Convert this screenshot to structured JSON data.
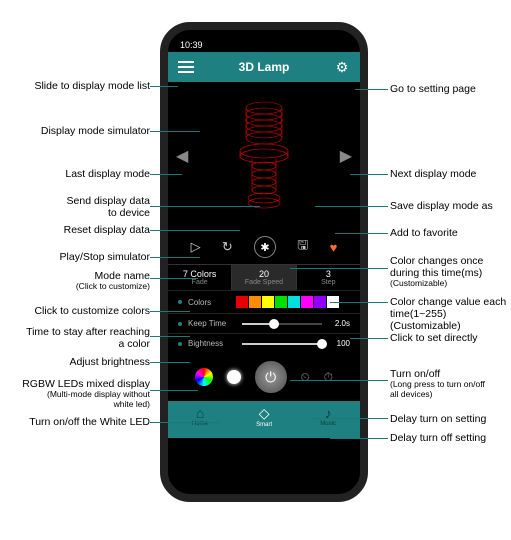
{
  "status": {
    "time": "10:39"
  },
  "header": {
    "title": "3D Lamp"
  },
  "controls": {
    "mode": {
      "val": "7 Colors",
      "lbl": "Fade"
    },
    "speed": {
      "val": "20",
      "lbl": "Fade Speed"
    },
    "step": {
      "val": "3",
      "lbl": "Step"
    }
  },
  "settings": {
    "colors_lbl": "Colors",
    "keep_lbl": "Keep Time",
    "keep_val": "2.0s",
    "bright_lbl": "Bightness",
    "bright_val": "100"
  },
  "swatches": [
    "#e60000",
    "#ff8c00",
    "#ffff00",
    "#00e000",
    "#00e0e0",
    "#ff00ff",
    "#9000ff",
    "#ffffff"
  ],
  "nav": {
    "home": "Home",
    "smart": "Smart",
    "music": "Music"
  },
  "callouts": {
    "l1": "Slide to display mode list",
    "l2": "Display mode simulator",
    "l3": "Last display mode",
    "l4a": "Send display data",
    "l4b": "to device",
    "l5": "Reset display data",
    "l6": "Play/Stop simulator",
    "l7a": "Mode name",
    "l7b": "(Click to customize)",
    "l8": "Click to customize colors",
    "l9a": "Time to stay after reaching",
    "l9b": "a color",
    "l10": "Adjust brightness",
    "l11a": "RGBW LEDs mixed display",
    "l11b": "(Multi-mode display without",
    "l11c": "white led)",
    "l12": "Turn on/off  the White LED",
    "r1": "Go to setting page",
    "r2": "Next display mode",
    "r3": "Save  display mode as",
    "r4": "Add to favorite",
    "r5a": "Color changes once",
    "r5b": "during this time(ms)",
    "r5c": "(Customizable)",
    "r6a": "Color change value each",
    "r6b": "time(1~255)(Customizable)",
    "r7": "Click to set directly",
    "r8a": "Turn on/off",
    "r8b": "(Long press to turn on/off",
    "r8c": " all  devices)",
    "r9": "Delay turn on setting",
    "r10": "Delay turn off setting"
  }
}
